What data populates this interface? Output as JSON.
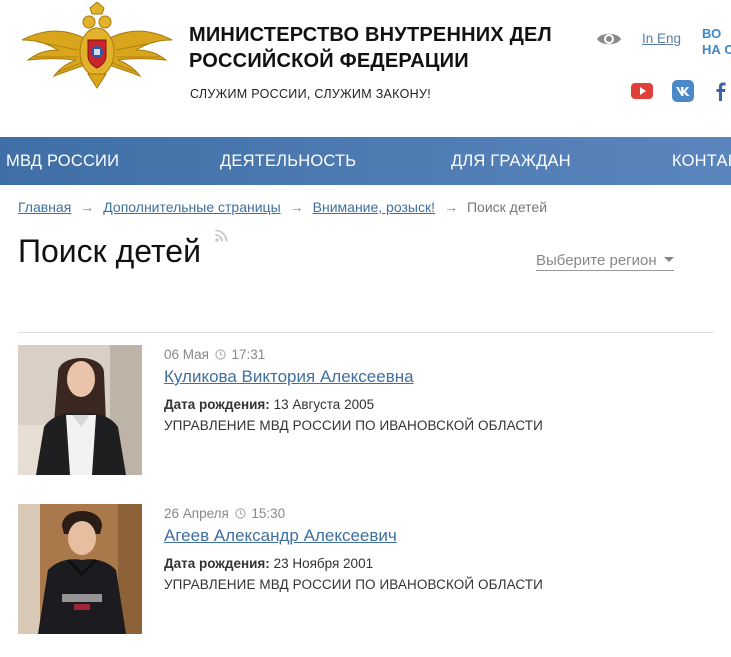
{
  "header": {
    "title_line1": "МИНИСТЕРСТВО ВНУТРЕННИХ ДЕЛ",
    "title_line2": "РОССИЙСКОЙ ФЕДЕРАЦИИ",
    "motto": "СЛУЖИМ РОССИИ, СЛУЖИМ ЗАКОНУ!",
    "lang_link": "In Eng",
    "top_right_line1": "ВО",
    "top_right_line2": "НА С"
  },
  "nav": {
    "items": [
      "МВД РОССИИ",
      "ДЕЯТЕЛЬНОСТЬ",
      "ДЛЯ ГРАЖДАН",
      "КОНТАК"
    ]
  },
  "breadcrumb": {
    "items": [
      "Главная",
      "Дополнительные страницы",
      "Внимание, розыск!"
    ],
    "current": "Поиск детей",
    "separator": "→"
  },
  "page": {
    "title": "Поиск детей",
    "region_select": "Выберите регион"
  },
  "entries": [
    {
      "date": "06 Мая",
      "time": "17:31",
      "name": "Куликова Виктория Алексеевна",
      "birth_label": "Дата рождения:",
      "birth_date": "13 Августа 2005",
      "department": "УПРАВЛЕНИЕ МВД РОССИИ ПО ИВАНОВСКОЙ ОБЛАСТИ"
    },
    {
      "date": "26 Апреля",
      "time": "15:30",
      "name": "Агеев Александр Алексеевич",
      "birth_label": "Дата рождения:",
      "birth_date": "23 Ноября 2001",
      "department": "УПРАВЛЕНИЕ МВД РОССИИ ПО ИВАНОВСКОЙ ОБЛАСТИ"
    }
  ],
  "colors": {
    "nav_bg": "#4a78b0",
    "link": "#3f6fa0",
    "accent": "#3e88c8",
    "youtube": "#e0403a",
    "vk": "#4a88c8",
    "facebook": "#3b64a8"
  }
}
